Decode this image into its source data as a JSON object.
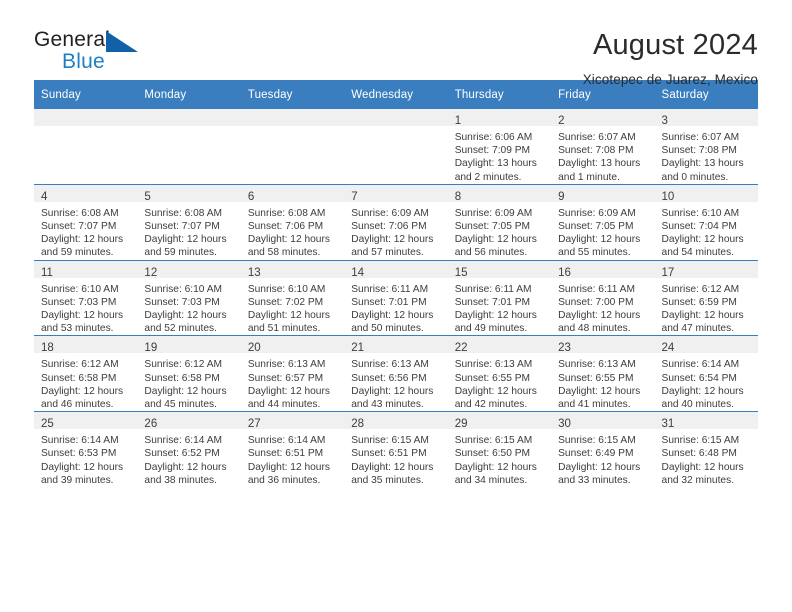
{
  "brand": {
    "word_one": "General",
    "word_two": "Blue",
    "triangle_icon": "brand-triangle-icon"
  },
  "header": {
    "title": "August 2024",
    "subtitle": "Xicotepec de Juarez, Mexico"
  },
  "colors": {
    "header_blue": "#3a7ebf",
    "brand_blue": "#1f7fc4",
    "daynum_band": "#f0f0f0",
    "text": "#3d3d3d"
  },
  "calendar": {
    "weekday_headers": [
      "Sunday",
      "Monday",
      "Tuesday",
      "Wednesday",
      "Thursday",
      "Friday",
      "Saturday"
    ],
    "weeks": [
      [
        {
          "day": "",
          "sunrise": "",
          "sunset": "",
          "daylight1": "",
          "daylight2": ""
        },
        {
          "day": "",
          "sunrise": "",
          "sunset": "",
          "daylight1": "",
          "daylight2": ""
        },
        {
          "day": "",
          "sunrise": "",
          "sunset": "",
          "daylight1": "",
          "daylight2": ""
        },
        {
          "day": "",
          "sunrise": "",
          "sunset": "",
          "daylight1": "",
          "daylight2": ""
        },
        {
          "day": "1",
          "sunrise": "Sunrise: 6:06 AM",
          "sunset": "Sunset: 7:09 PM",
          "daylight1": "Daylight: 13 hours",
          "daylight2": "and 2 minutes."
        },
        {
          "day": "2",
          "sunrise": "Sunrise: 6:07 AM",
          "sunset": "Sunset: 7:08 PM",
          "daylight1": "Daylight: 13 hours",
          "daylight2": "and 1 minute."
        },
        {
          "day": "3",
          "sunrise": "Sunrise: 6:07 AM",
          "sunset": "Sunset: 7:08 PM",
          "daylight1": "Daylight: 13 hours",
          "daylight2": "and 0 minutes."
        }
      ],
      [
        {
          "day": "4",
          "sunrise": "Sunrise: 6:08 AM",
          "sunset": "Sunset: 7:07 PM",
          "daylight1": "Daylight: 12 hours",
          "daylight2": "and 59 minutes."
        },
        {
          "day": "5",
          "sunrise": "Sunrise: 6:08 AM",
          "sunset": "Sunset: 7:07 PM",
          "daylight1": "Daylight: 12 hours",
          "daylight2": "and 59 minutes."
        },
        {
          "day": "6",
          "sunrise": "Sunrise: 6:08 AM",
          "sunset": "Sunset: 7:06 PM",
          "daylight1": "Daylight: 12 hours",
          "daylight2": "and 58 minutes."
        },
        {
          "day": "7",
          "sunrise": "Sunrise: 6:09 AM",
          "sunset": "Sunset: 7:06 PM",
          "daylight1": "Daylight: 12 hours",
          "daylight2": "and 57 minutes."
        },
        {
          "day": "8",
          "sunrise": "Sunrise: 6:09 AM",
          "sunset": "Sunset: 7:05 PM",
          "daylight1": "Daylight: 12 hours",
          "daylight2": "and 56 minutes."
        },
        {
          "day": "9",
          "sunrise": "Sunrise: 6:09 AM",
          "sunset": "Sunset: 7:05 PM",
          "daylight1": "Daylight: 12 hours",
          "daylight2": "and 55 minutes."
        },
        {
          "day": "10",
          "sunrise": "Sunrise: 6:10 AM",
          "sunset": "Sunset: 7:04 PM",
          "daylight1": "Daylight: 12 hours",
          "daylight2": "and 54 minutes."
        }
      ],
      [
        {
          "day": "11",
          "sunrise": "Sunrise: 6:10 AM",
          "sunset": "Sunset: 7:03 PM",
          "daylight1": "Daylight: 12 hours",
          "daylight2": "and 53 minutes."
        },
        {
          "day": "12",
          "sunrise": "Sunrise: 6:10 AM",
          "sunset": "Sunset: 7:03 PM",
          "daylight1": "Daylight: 12 hours",
          "daylight2": "and 52 minutes."
        },
        {
          "day": "13",
          "sunrise": "Sunrise: 6:10 AM",
          "sunset": "Sunset: 7:02 PM",
          "daylight1": "Daylight: 12 hours",
          "daylight2": "and 51 minutes."
        },
        {
          "day": "14",
          "sunrise": "Sunrise: 6:11 AM",
          "sunset": "Sunset: 7:01 PM",
          "daylight1": "Daylight: 12 hours",
          "daylight2": "and 50 minutes."
        },
        {
          "day": "15",
          "sunrise": "Sunrise: 6:11 AM",
          "sunset": "Sunset: 7:01 PM",
          "daylight1": "Daylight: 12 hours",
          "daylight2": "and 49 minutes."
        },
        {
          "day": "16",
          "sunrise": "Sunrise: 6:11 AM",
          "sunset": "Sunset: 7:00 PM",
          "daylight1": "Daylight: 12 hours",
          "daylight2": "and 48 minutes."
        },
        {
          "day": "17",
          "sunrise": "Sunrise: 6:12 AM",
          "sunset": "Sunset: 6:59 PM",
          "daylight1": "Daylight: 12 hours",
          "daylight2": "and 47 minutes."
        }
      ],
      [
        {
          "day": "18",
          "sunrise": "Sunrise: 6:12 AM",
          "sunset": "Sunset: 6:58 PM",
          "daylight1": "Daylight: 12 hours",
          "daylight2": "and 46 minutes."
        },
        {
          "day": "19",
          "sunrise": "Sunrise: 6:12 AM",
          "sunset": "Sunset: 6:58 PM",
          "daylight1": "Daylight: 12 hours",
          "daylight2": "and 45 minutes."
        },
        {
          "day": "20",
          "sunrise": "Sunrise: 6:13 AM",
          "sunset": "Sunset: 6:57 PM",
          "daylight1": "Daylight: 12 hours",
          "daylight2": "and 44 minutes."
        },
        {
          "day": "21",
          "sunrise": "Sunrise: 6:13 AM",
          "sunset": "Sunset: 6:56 PM",
          "daylight1": "Daylight: 12 hours",
          "daylight2": "and 43 minutes."
        },
        {
          "day": "22",
          "sunrise": "Sunrise: 6:13 AM",
          "sunset": "Sunset: 6:55 PM",
          "daylight1": "Daylight: 12 hours",
          "daylight2": "and 42 minutes."
        },
        {
          "day": "23",
          "sunrise": "Sunrise: 6:13 AM",
          "sunset": "Sunset: 6:55 PM",
          "daylight1": "Daylight: 12 hours",
          "daylight2": "and 41 minutes."
        },
        {
          "day": "24",
          "sunrise": "Sunrise: 6:14 AM",
          "sunset": "Sunset: 6:54 PM",
          "daylight1": "Daylight: 12 hours",
          "daylight2": "and 40 minutes."
        }
      ],
      [
        {
          "day": "25",
          "sunrise": "Sunrise: 6:14 AM",
          "sunset": "Sunset: 6:53 PM",
          "daylight1": "Daylight: 12 hours",
          "daylight2": "and 39 minutes."
        },
        {
          "day": "26",
          "sunrise": "Sunrise: 6:14 AM",
          "sunset": "Sunset: 6:52 PM",
          "daylight1": "Daylight: 12 hours",
          "daylight2": "and 38 minutes."
        },
        {
          "day": "27",
          "sunrise": "Sunrise: 6:14 AM",
          "sunset": "Sunset: 6:51 PM",
          "daylight1": "Daylight: 12 hours",
          "daylight2": "and 36 minutes."
        },
        {
          "day": "28",
          "sunrise": "Sunrise: 6:15 AM",
          "sunset": "Sunset: 6:51 PM",
          "daylight1": "Daylight: 12 hours",
          "daylight2": "and 35 minutes."
        },
        {
          "day": "29",
          "sunrise": "Sunrise: 6:15 AM",
          "sunset": "Sunset: 6:50 PM",
          "daylight1": "Daylight: 12 hours",
          "daylight2": "and 34 minutes."
        },
        {
          "day": "30",
          "sunrise": "Sunrise: 6:15 AM",
          "sunset": "Sunset: 6:49 PM",
          "daylight1": "Daylight: 12 hours",
          "daylight2": "and 33 minutes."
        },
        {
          "day": "31",
          "sunrise": "Sunrise: 6:15 AM",
          "sunset": "Sunset: 6:48 PM",
          "daylight1": "Daylight: 12 hours",
          "daylight2": "and 32 minutes."
        }
      ]
    ]
  }
}
